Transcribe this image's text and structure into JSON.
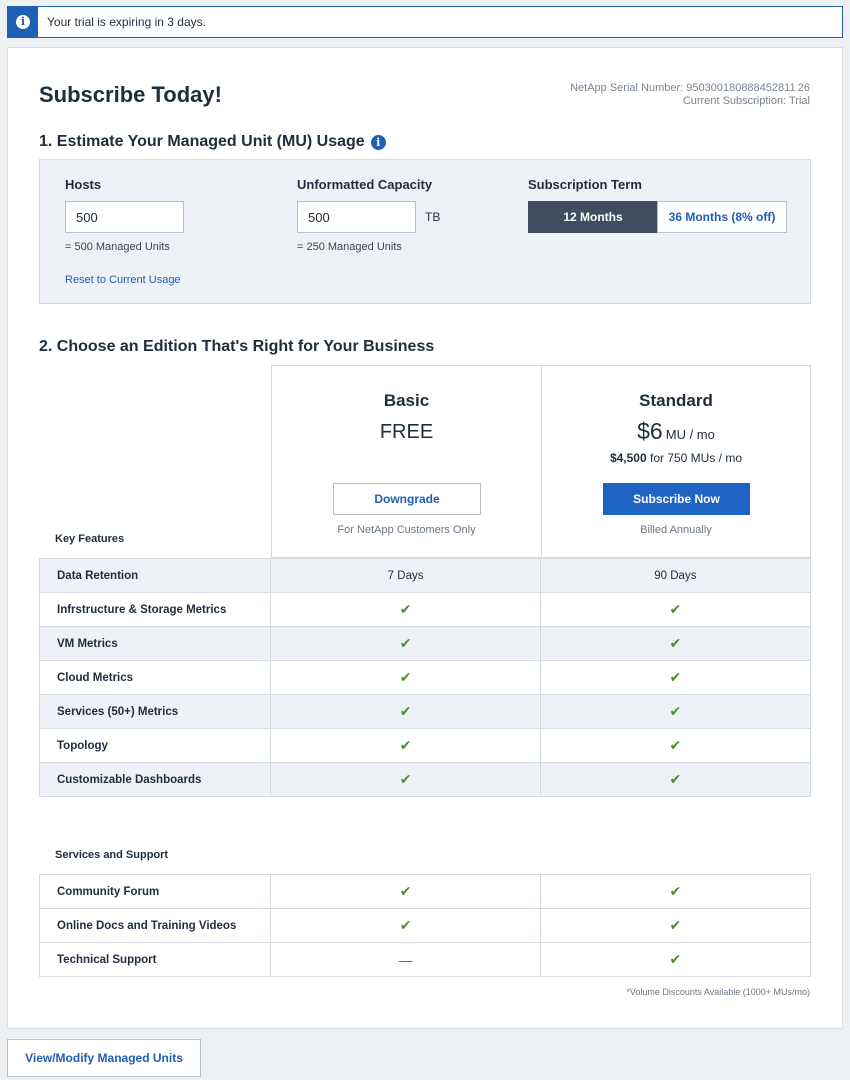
{
  "banner": {
    "icon": "info-icon",
    "text": "Your trial is expiring in 3 days."
  },
  "header": {
    "title": "Subscribe Today!",
    "serial_line": "NetApp Serial Number: 950300180888452811 26",
    "subscription_line": "Current Subscription: Trial"
  },
  "estimate": {
    "section_title": "1. Estimate Your Managed Unit (MU) Usage",
    "hosts": {
      "label": "Hosts",
      "value": "500",
      "note": "= 500 Managed Units",
      "reset": "Reset to Current Usage"
    },
    "capacity": {
      "label": "Unformatted Capacity",
      "value": "500",
      "unit": "TB",
      "note": "= 250 Managed Units"
    },
    "term": {
      "label": "Subscription Term",
      "option_12": "12 Months",
      "option_36": "36 Months (8% off)",
      "selected": "12 Months"
    }
  },
  "editions": {
    "section_title": "2. Choose an Edition That's Right for Your Business",
    "basic": {
      "name": "Basic",
      "price": "FREE",
      "button": "Downgrade",
      "note": "For NetApp Customers Only"
    },
    "standard": {
      "name": "Standard",
      "price": "$6",
      "price_unit": "MU / mo",
      "total_bold": "$4,500",
      "total_rest": " for 750 MUs / mo",
      "button": "Subscribe Now",
      "note": "Billed Annually"
    }
  },
  "key_features": {
    "label": "Key Features",
    "rows": [
      {
        "name": "Data Retention",
        "basic": "7 Days",
        "standard": "90 Days"
      },
      {
        "name": "Infrstructure & Storage Metrics",
        "basic": "check",
        "standard": "check"
      },
      {
        "name": "VM Metrics",
        "basic": "check",
        "standard": "check"
      },
      {
        "name": "Cloud Metrics",
        "basic": "check",
        "standard": "check"
      },
      {
        "name": "Services (50+) Metrics",
        "basic": "check",
        "standard": "check"
      },
      {
        "name": "Topology",
        "basic": "check",
        "standard": "check"
      },
      {
        "name": "Customizable Dashboards",
        "basic": "check",
        "standard": "check"
      }
    ]
  },
  "services_support": {
    "label": "Services and Support",
    "rows": [
      {
        "name": "Community Forum",
        "basic": "check",
        "standard": "check"
      },
      {
        "name": "Online Docs and Training Videos",
        "basic": "check",
        "standard": "check"
      },
      {
        "name": "Technical Support",
        "basic": "dash",
        "standard": "check"
      }
    ]
  },
  "footnote": "*Volume Discounts Available (1000+ MUs/mo)",
  "footer": {
    "button": "View/Modify Managed Units"
  },
  "colors": {
    "accent": "#1f64c4",
    "active_term": "#3e4e61",
    "check": "#4c8c2f",
    "panel": "#eef2f6"
  }
}
